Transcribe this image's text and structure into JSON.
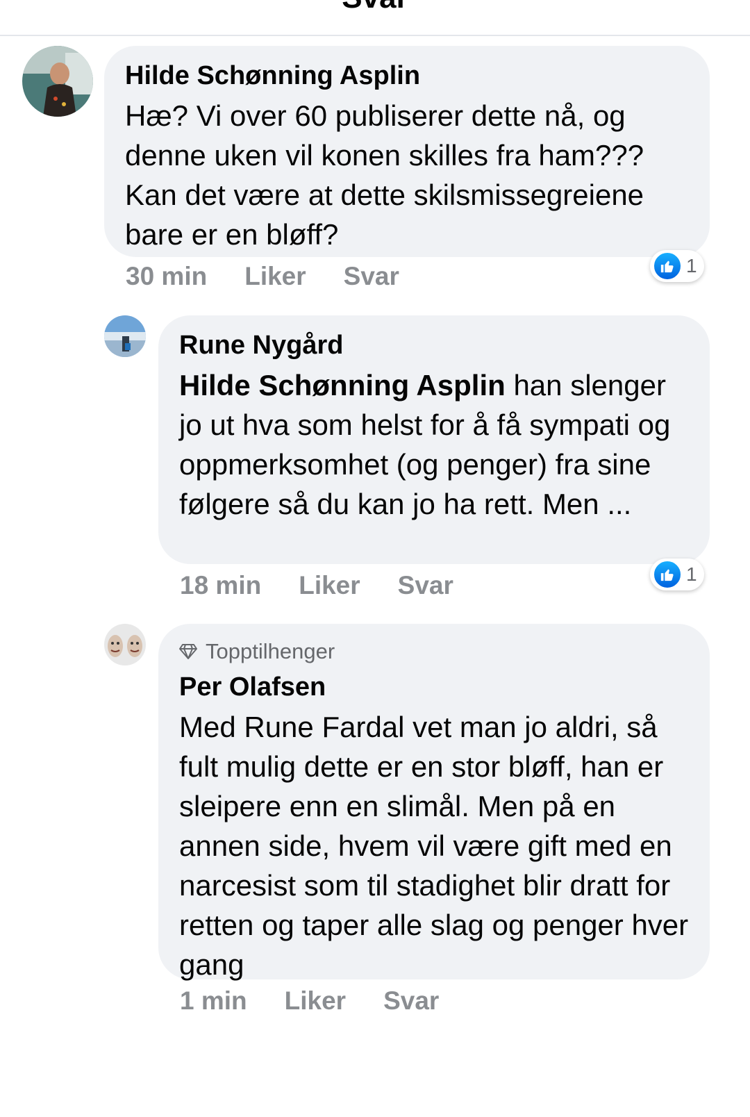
{
  "header": {
    "title": "Svar"
  },
  "icons": {
    "back": "back-arrow-icon",
    "like": "thumbs-up-icon",
    "badge": "diamond-icon"
  },
  "colors": {
    "like_blue": "#1877f2",
    "bubble_bg": "#f0f2f5",
    "meta_gray": "#8a8d91"
  },
  "comments": [
    {
      "author": "Hilde Schønning Asplin",
      "text": "Hæ? Vi over 60 publiserer dette nå, og denne uken vil konen skilles fra ham??? Kan det være at dette skilsmissegreiene bare er en bløff?",
      "time": "30 min",
      "like_label": "Liker",
      "reply_label": "Svar",
      "reaction_count": "1"
    },
    {
      "author": "Rune Nygård",
      "mention": "Hilde Schønning Asplin",
      "text": "han slenger jo ut hva som helst for å få sympati og oppmerksomhet (og penger) fra sine følgere så du kan jo ha rett. Men ...",
      "time": "18 min",
      "like_label": "Liker",
      "reply_label": "Svar",
      "reaction_count": "1"
    },
    {
      "badge": "Topptilhenger",
      "author": "Per Olafsen",
      "text": "Med Rune Fardal vet man jo aldri, så fult mulig dette er en stor bløff, han er sleipere enn en slimål. Men på en annen side, hvem vil være gift med en narcesist som til stadighet blir dratt for retten og taper alle slag og penger hver gang",
      "time": "1 min",
      "like_label": "Liker",
      "reply_label": "Svar"
    }
  ]
}
